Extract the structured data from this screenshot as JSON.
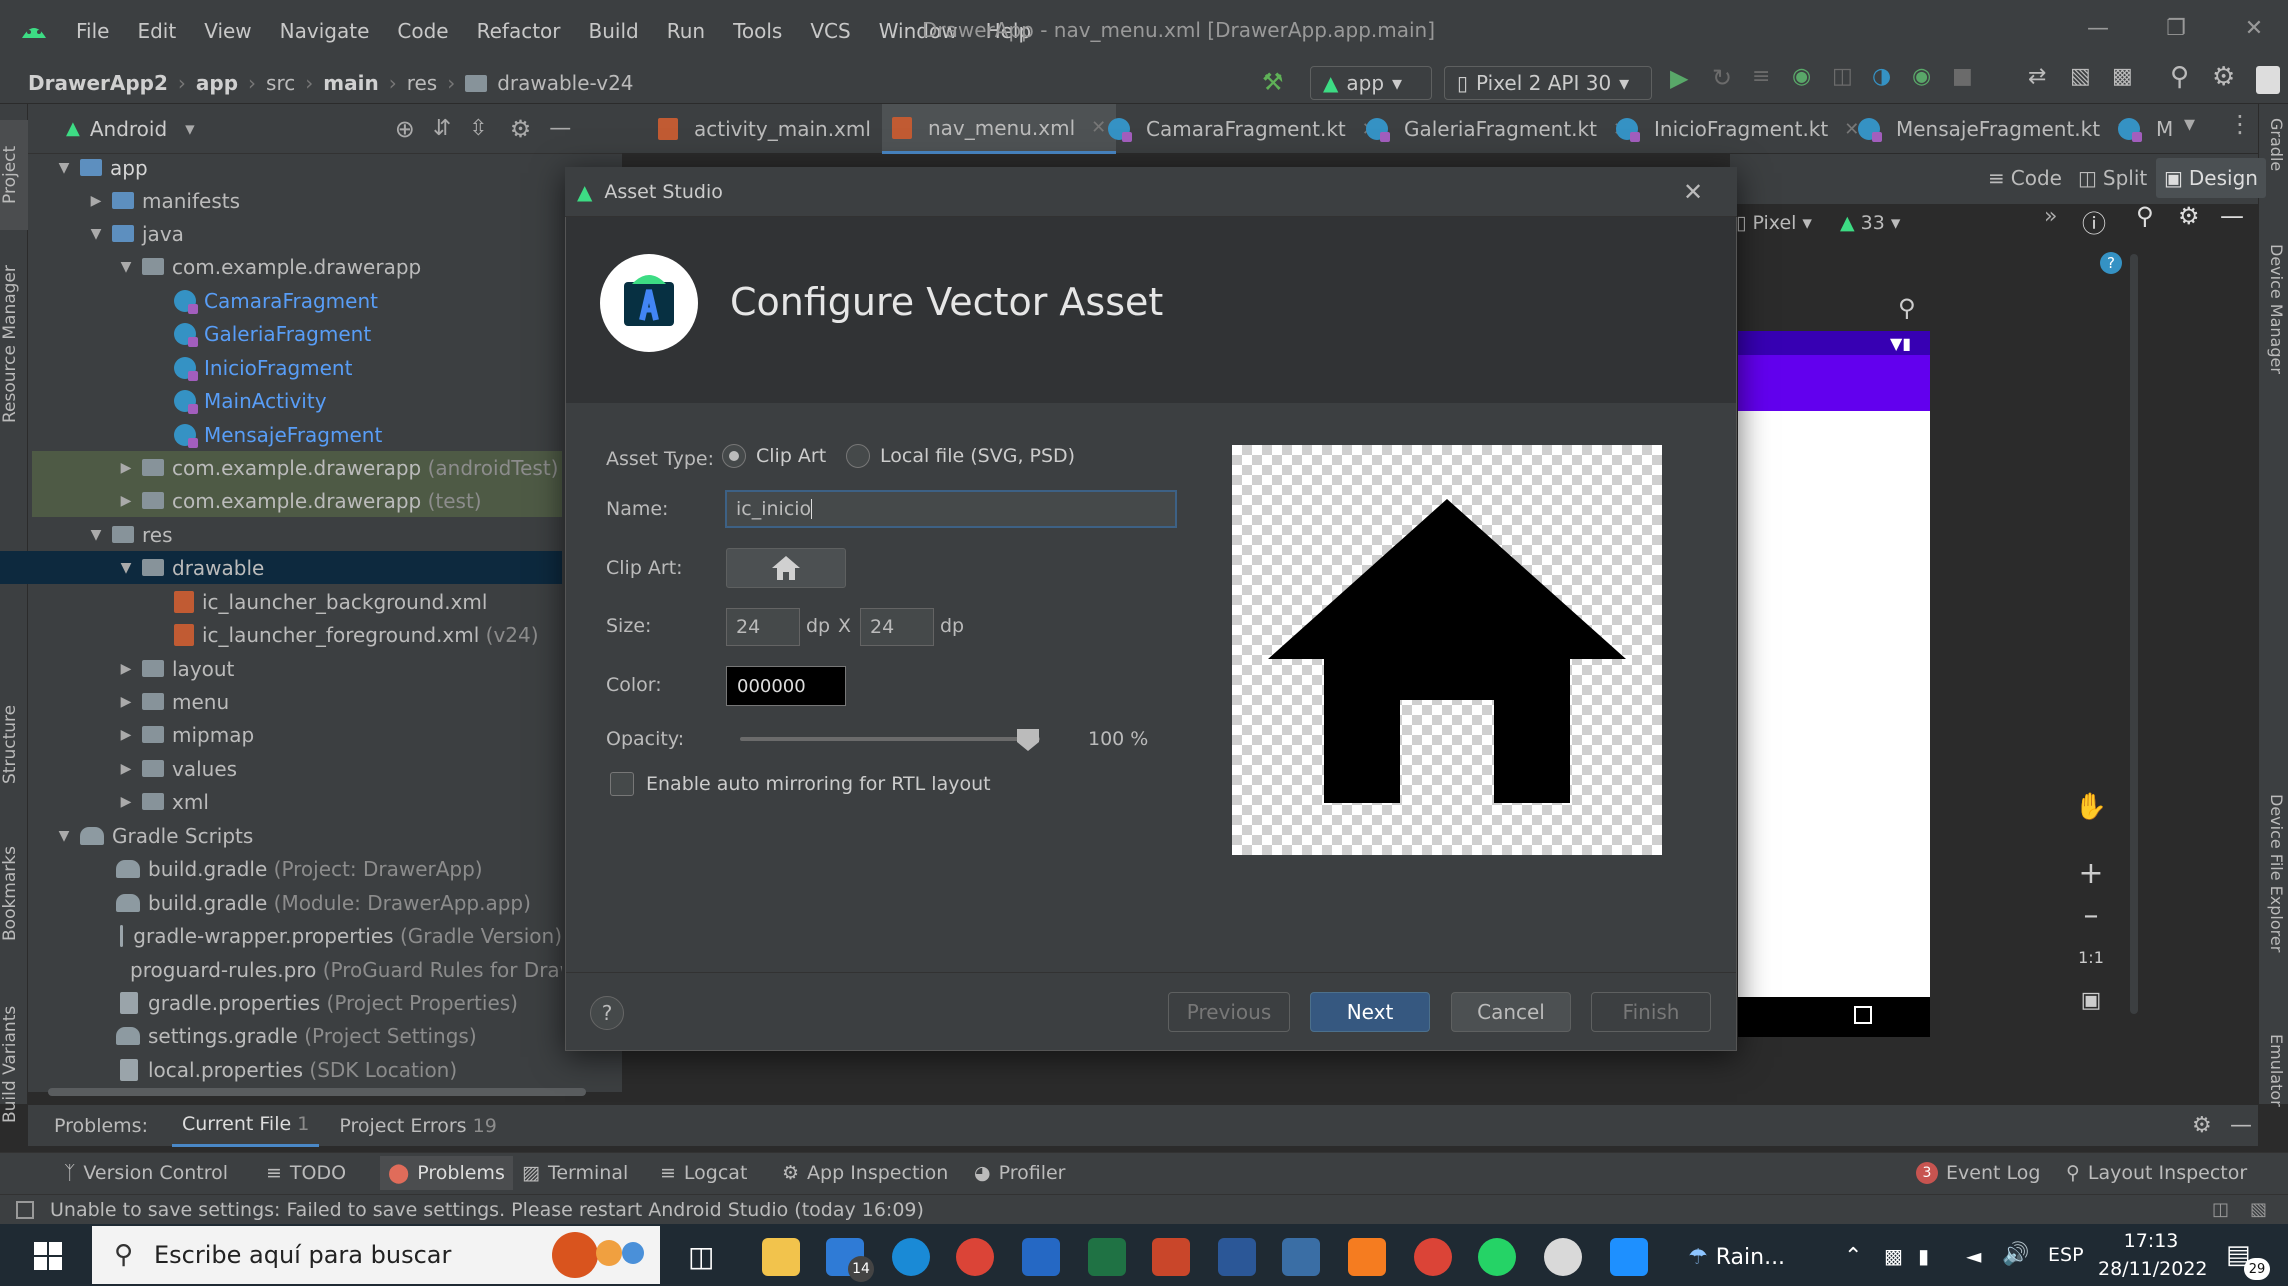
{
  "window": {
    "title": "DrawerApp - nav_menu.xml [DrawerApp.app.main]",
    "menu": [
      "File",
      "Edit",
      "View",
      "Navigate",
      "Code",
      "Refactor",
      "Build",
      "Run",
      "Tools",
      "VCS",
      "Window",
      "Help"
    ]
  },
  "breadcrumb": {
    "project": "DrawerApp2",
    "items": [
      "app",
      "src",
      "main",
      "res"
    ],
    "last": "drawable-v24"
  },
  "toolbar": {
    "run_config": "app",
    "device": "Pixel 2 API 30"
  },
  "project_panel": {
    "view": "Android",
    "tree": [
      {
        "label": "app",
        "extra": ""
      },
      {
        "label": "manifests",
        "extra": ""
      },
      {
        "label": "java",
        "extra": ""
      },
      {
        "label": "com.example.drawerapp",
        "extra": ""
      },
      {
        "label": "CamaraFragment",
        "extra": ""
      },
      {
        "label": "GaleriaFragment",
        "extra": ""
      },
      {
        "label": "InicioFragment",
        "extra": ""
      },
      {
        "label": "MainActivity",
        "extra": ""
      },
      {
        "label": "MensajeFragment",
        "extra": ""
      },
      {
        "label": "com.example.drawerapp",
        "extra": "(androidTest)"
      },
      {
        "label": "com.example.drawerapp",
        "extra": "(test)"
      },
      {
        "label": "res",
        "extra": ""
      },
      {
        "label": "drawable",
        "extra": ""
      },
      {
        "label": "ic_launcher_background.xml",
        "extra": ""
      },
      {
        "label": "ic_launcher_foreground.xml",
        "extra": "(v24)"
      },
      {
        "label": "layout",
        "extra": ""
      },
      {
        "label": "menu",
        "extra": ""
      },
      {
        "label": "mipmap",
        "extra": ""
      },
      {
        "label": "values",
        "extra": ""
      },
      {
        "label": "xml",
        "extra": ""
      },
      {
        "label": "Gradle Scripts",
        "extra": ""
      },
      {
        "label": "build.gradle",
        "extra": "(Project: DrawerApp)"
      },
      {
        "label": "build.gradle",
        "extra": "(Module: DrawerApp.app)"
      },
      {
        "label": "gradle-wrapper.properties",
        "extra": "(Gradle Version)"
      },
      {
        "label": "proguard-rules.pro",
        "extra": "(ProGuard Rules for DrawerA"
      },
      {
        "label": "gradle.properties",
        "extra": "(Project Properties)"
      },
      {
        "label": "settings.gradle",
        "extra": "(Project Settings)"
      },
      {
        "label": "local.properties",
        "extra": "(SDK Location)"
      }
    ]
  },
  "editor_tabs": [
    "activity_main.xml",
    "nav_menu.xml",
    "CamaraFragment.kt",
    "GaleriaFragment.kt",
    "InicioFragment.kt",
    "MensajeFragment.kt",
    "M"
  ],
  "design_toolbar": {
    "code": "Code",
    "split": "Split",
    "design": "Design",
    "device": "Pixel",
    "api": "33"
  },
  "left_strip": [
    "Project",
    "Resource Manager",
    "Structure",
    "Bookmarks",
    "Build Variants"
  ],
  "right_strip": [
    "Gradle",
    "Device Manager",
    "Device File Explorer",
    "Emulator"
  ],
  "dialog": {
    "title": "Asset Studio",
    "heading": "Configure Vector Asset",
    "asset_type_label": "Asset Type:",
    "asset_type_options": [
      "Clip Art",
      "Local file (SVG, PSD)"
    ],
    "name_label": "Name:",
    "name_value": "ic_inicio",
    "clipart_label": "Clip Art:",
    "size_label": "Size:",
    "size_w": "24",
    "size_h": "24",
    "dp": "dp",
    "x": "X",
    "color_label": "Color:",
    "color_value": "000000",
    "opacity_label": "Opacity:",
    "opacity_value": "100 %",
    "opacity_fraction": 1.0,
    "mirror_label": "Enable auto mirroring for RTL layout",
    "buttons": {
      "previous": "Previous",
      "next": "Next",
      "cancel": "Cancel",
      "finish": "Finish"
    },
    "help": "?"
  },
  "problems_bar": {
    "label": "Problems:",
    "current_file": "Current File",
    "current_count": "1",
    "project_errors": "Project Errors",
    "project_count": "19"
  },
  "tool_windows": [
    "Version Control",
    "TODO",
    "Problems",
    "Terminal",
    "Logcat",
    "App Inspection",
    "Profiler"
  ],
  "tool_windows_right": {
    "event_log_count": "3",
    "event_log": "Event Log",
    "layout_inspector": "Layout Inspector"
  },
  "status_message": "Unable to save settings: Failed to save settings. Please restart Android Studio (today 16:09)",
  "taskbar": {
    "search_placeholder": "Escribe aquí para buscar",
    "weather": "Rain...",
    "lang": "ESP",
    "time": "17:13",
    "date": "28/11/2022",
    "mail_badge": "14",
    "notif_badge": "29"
  },
  "colors": {
    "accent": "#589df6",
    "purple_bar": "#6200ee",
    "next_button": "#365880"
  }
}
